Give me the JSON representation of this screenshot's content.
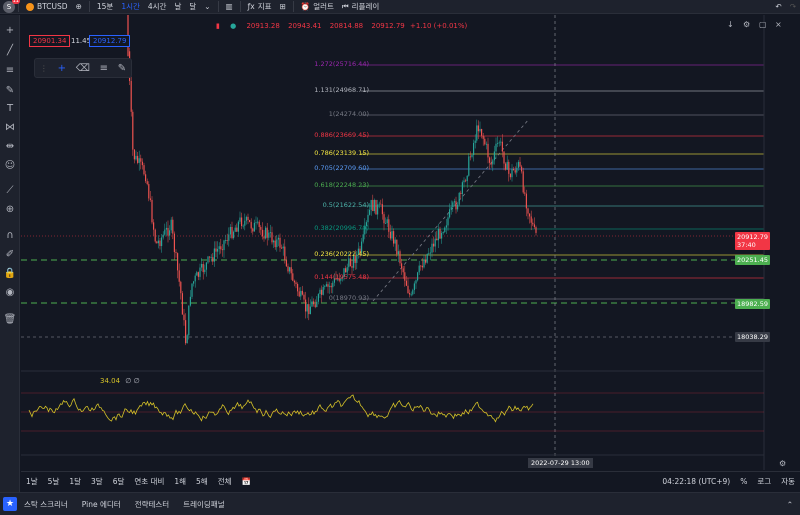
{
  "topbar": {
    "avatar_letter": "S",
    "avatar_badge": "11",
    "symbol": "BTCUSD",
    "timeframes": [
      "15분",
      "1시간",
      "4시간",
      "날",
      "달"
    ],
    "active_timeframe": "1시간",
    "indicators_label": "지표",
    "alert_label": "얼러트",
    "replay_label": "리플레이"
  },
  "legend": {
    "open": "20913.28",
    "high": "20943.41",
    "low": "20814.88",
    "close": "20912.79",
    "change": "+1.10 (+0.01%)"
  },
  "bid": "20901.34",
  "spread": "11.45",
  "ask": "20912.79",
  "fib_levels": [
    {
      "label": "1.272(25716.44)",
      "color": "#9c27b0"
    },
    {
      "label": "1.131(24968.71)",
      "color": "#b2b5be"
    },
    {
      "label": "1(24274.00)",
      "color": "#787b86"
    },
    {
      "label": "0.886(23669.45)",
      "color": "#f23645"
    },
    {
      "label": "0.786(23139.15)",
      "color": "#f5e742"
    },
    {
      "label": "0.705(22709.60)",
      "color": "#5b9cf6"
    },
    {
      "label": "0.618(22248.23)",
      "color": "#4caf50"
    },
    {
      "label": "0.5(21622.54)",
      "color": "#4db6ac"
    },
    {
      "label": "0.382(20996.70)",
      "color": "#089981"
    },
    {
      "label": "0.236(20222.45)",
      "color": "#f5e742"
    },
    {
      "label": "0.144(19575.48)",
      "color": "#f23645"
    },
    {
      "label": "0(18970.93)",
      "color": "#787b86"
    }
  ],
  "price_labels": {
    "current": "20912.79",
    "countdown": "37:40",
    "level_1": "20251.45",
    "level_2": "18982.59",
    "crosshair": "18038.29"
  },
  "rsi": {
    "value": "34.04",
    "extra": "∅ ∅"
  },
  "x_label": "2022-07-29   13:00",
  "range_buttons": [
    "1날",
    "5날",
    "1달",
    "3달",
    "6달",
    "연초 대비",
    "1해",
    "5해",
    "전체"
  ],
  "status": {
    "time": "04:22:18 (UTC+9)",
    "percent": "%",
    "log": "로그",
    "auto": "자동"
  },
  "bottom_tabs": [
    "스탁 스크리너",
    "Pine 에디터",
    "전략테스터",
    "트레이딩패널"
  ],
  "colors": {
    "up": "#26a69a",
    "down": "#ef5350",
    "rsi": "#d4c128",
    "accent": "#2962ff",
    "dashed_level": "#4caf50"
  },
  "icons": {
    "crosshair": "crosshair-icon",
    "trendline": "trendline-icon",
    "fib": "fib-icon",
    "brush": "brush-icon",
    "text": "text-icon"
  }
}
